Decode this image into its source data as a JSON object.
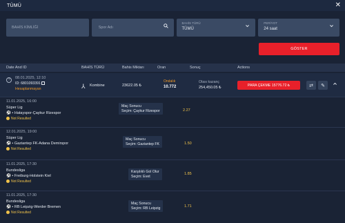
{
  "window": {
    "title": "TÜMÜ",
    "close": "✕"
  },
  "filters": {
    "bet_id_placeholder": "BAHİS KİMLİĞİ",
    "sport_placeholder": "Spor Adı",
    "bet_type_label": "BAHİS TÜRÜ",
    "bet_type_value": "TÜMÜ",
    "period_label": "PERİYOT",
    "period_value": "24 saat",
    "show_button": "GÖSTER"
  },
  "table": {
    "headers": [
      "Date And ID",
      "BAHİS TÜRÜ",
      "Bahis Miktarı",
      "Oran",
      "Sonuç",
      "Actions"
    ]
  },
  "bet": {
    "datetime": "08.01.2025, 12:10",
    "id": "6801093391",
    "status": "Hesaplanmayan",
    "type": "Kombine",
    "amount": "23622.05 ₺",
    "odds_label": "Ondalık",
    "odds_value": "10.772",
    "result_label": "Olası kazanç",
    "result_value": "254,450.05 ₺",
    "payout_button": "PARA ÇEKME 15776.72 ₺"
  },
  "matches": [
    {
      "date": "11.01.2025, 16:00",
      "league": "Süper Lig",
      "teams": "Hatayspor-Çaykur Rizespor",
      "status": "Not Resulted",
      "market": "Maç Sonucu",
      "selection": "Seçim: Çaykur Rizespor",
      "odd": "2.27"
    },
    {
      "date": "12.01.2025, 19:00",
      "league": "Süper Lig",
      "teams": "Gaziantep FK-Adana Demirspor",
      "status": "Not Resulted",
      "market": "Maç Sonucu",
      "selection": "Seçim: Gaziantep FK",
      "odd": "1.50"
    },
    {
      "date": "11.01.2025, 17:30",
      "league": "Bundesliga",
      "teams": "Freiburg-Holstein Kiel",
      "status": "Not Resulted",
      "market": "Karşılıklı Gol Olur",
      "selection": "Seçim: Evet",
      "odd": "1.85"
    },
    {
      "date": "11.01.2025, 17:30",
      "league": "Bundesliga",
      "teams": "RB Leipzig-Werder Bremen",
      "status": "Not Resulted",
      "market": "Maç Sonucu",
      "selection": "Seçim: RB Leipzig",
      "odd": "1.71"
    }
  ]
}
